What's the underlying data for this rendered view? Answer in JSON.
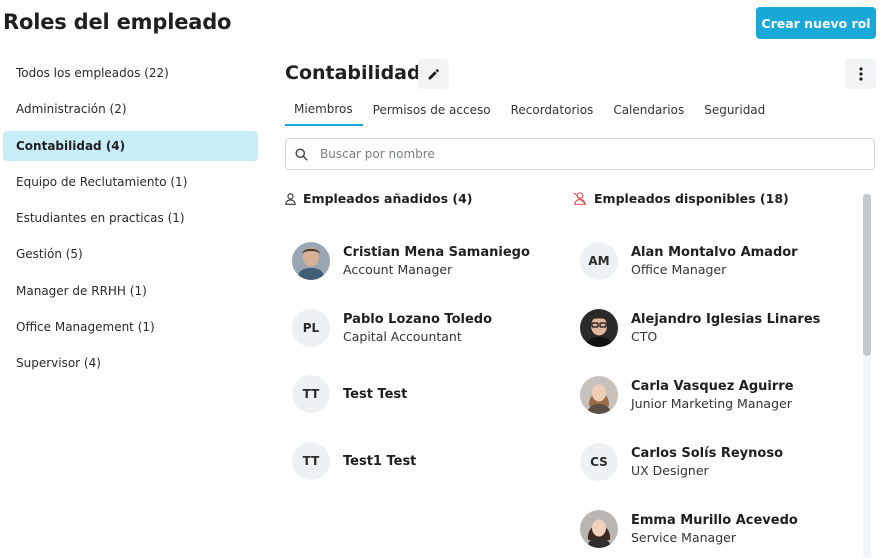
{
  "page": {
    "title": "Roles del empleado",
    "create_button": "Crear nuevo rol"
  },
  "sidebar": {
    "items": [
      {
        "label": "Todos los empleados (22)"
      },
      {
        "label": "Administración (2)"
      },
      {
        "label": "Contabilidad (4)",
        "active": true
      },
      {
        "label": "Equipo de Reclutamiento (1)"
      },
      {
        "label": "Estudiantes en practicas (1)"
      },
      {
        "label": "Gestión (5)"
      },
      {
        "label": "Manager de RRHH (1)"
      },
      {
        "label": "Office Management (1)"
      },
      {
        "label": "Supervisor (4)"
      }
    ]
  },
  "role": {
    "title": "Contabilidad",
    "tabs": [
      {
        "label": "Miembros",
        "active": true
      },
      {
        "label": "Permisos de acceso"
      },
      {
        "label": "Recordatorios"
      },
      {
        "label": "Calendarios"
      },
      {
        "label": "Seguridad"
      }
    ],
    "search_placeholder": "Buscar por nombre"
  },
  "added": {
    "header": "Empleados añadidos (4)",
    "people": [
      {
        "name": "Cristian Mena Samaniego",
        "role": "Account Manager",
        "photo": true
      },
      {
        "name": "Pablo Lozano Toledo",
        "role": "Capital Accountant",
        "initials": "PL"
      },
      {
        "name": "Test Test",
        "role": "",
        "initials": "TT"
      },
      {
        "name": "Test1 Test",
        "role": "",
        "initials": "TT"
      }
    ]
  },
  "available": {
    "header": "Empleados disponibles (18)",
    "people": [
      {
        "name": "Alan Montalvo Amador",
        "role": "Office Manager",
        "initials": "AM"
      },
      {
        "name": "Alejandro Iglesias Linares",
        "role": "CTO",
        "photo": true
      },
      {
        "name": "Carla Vasquez Aguirre",
        "role": "Junior Marketing Manager",
        "photo": true
      },
      {
        "name": "Carlos Solís Reynoso",
        "role": "UX Designer",
        "initials": "CS"
      },
      {
        "name": "Emma Murillo Acevedo",
        "role": "Service Manager",
        "photo": true
      }
    ]
  },
  "colors": {
    "accent": "#19a9d8",
    "active_bg": "#c9edf7",
    "avatar_bg": "#eef1f4",
    "unavailable_icon": "#e05a5a"
  }
}
